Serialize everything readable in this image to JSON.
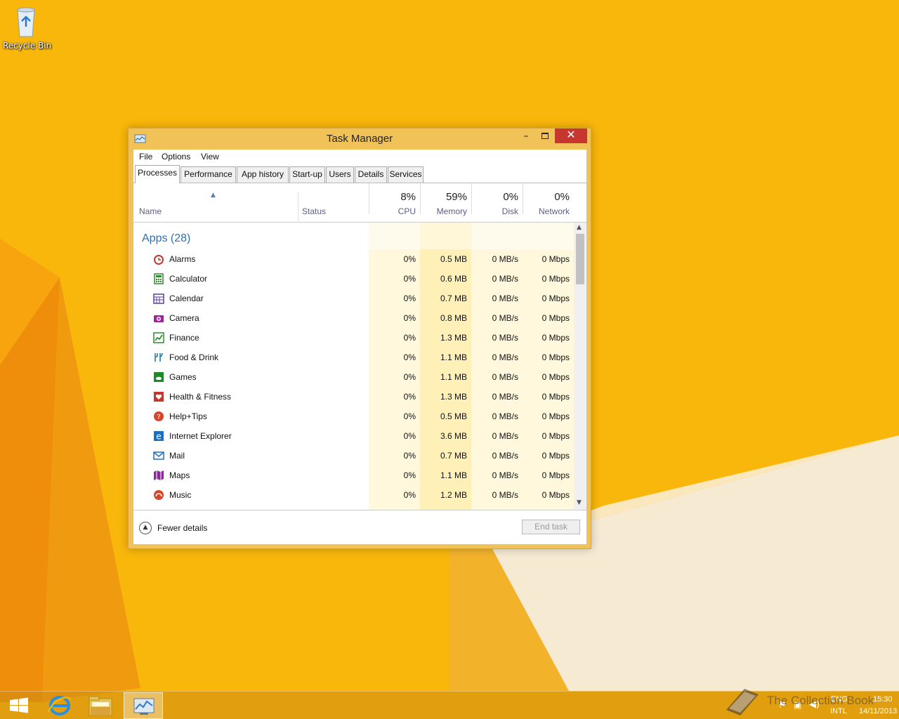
{
  "desktop": {
    "recycle_bin_label": "Recycle Bin"
  },
  "window": {
    "title": "Task Manager",
    "close_glyph": "✕",
    "menu": [
      "File",
      "Options",
      "View"
    ],
    "tabs": [
      "Processes",
      "Performance",
      "App history",
      "Start-up",
      "Users",
      "Details",
      "Services"
    ],
    "active_tab": "Processes",
    "columns": {
      "name": "Name",
      "status": "Status",
      "cpu": {
        "percent": "8%",
        "label": "CPU"
      },
      "memory": {
        "percent": "59%",
        "label": "Memory"
      },
      "disk": {
        "percent": "0%",
        "label": "Disk"
      },
      "network": {
        "percent": "0%",
        "label": "Network"
      }
    },
    "group_title": "Apps (28)",
    "rows": [
      {
        "name": "Alarms",
        "icon": "alarms-icon",
        "color": "#c0392b",
        "cpu": "0%",
        "memory": "0.5 MB",
        "disk": "0 MB/s",
        "network": "0 Mbps"
      },
      {
        "name": "Calculator",
        "icon": "calculator-icon",
        "color": "#2e8b2e",
        "cpu": "0%",
        "memory": "0.6 MB",
        "disk": "0 MB/s",
        "network": "0 Mbps"
      },
      {
        "name": "Calendar",
        "icon": "calendar-icon",
        "color": "#5b3fa0",
        "cpu": "0%",
        "memory": "0.7 MB",
        "disk": "0 MB/s",
        "network": "0 Mbps"
      },
      {
        "name": "Camera",
        "icon": "camera-icon",
        "color": "#a0259a",
        "cpu": "0%",
        "memory": "0.8 MB",
        "disk": "0 MB/s",
        "network": "0 Mbps"
      },
      {
        "name": "Finance",
        "icon": "finance-icon",
        "color": "#2e8b2e",
        "cpu": "0%",
        "memory": "1.3 MB",
        "disk": "0 MB/s",
        "network": "0 Mbps"
      },
      {
        "name": "Food & Drink",
        "icon": "food-drink-icon",
        "color": "#1f7fa8",
        "cpu": "0%",
        "memory": "1.1 MB",
        "disk": "0 MB/s",
        "network": "0 Mbps"
      },
      {
        "name": "Games",
        "icon": "games-icon",
        "color": "#1d8a2a",
        "cpu": "0%",
        "memory": "1.1 MB",
        "disk": "0 MB/s",
        "network": "0 Mbps"
      },
      {
        "name": "Health & Fitness",
        "icon": "health-fitness-icon",
        "color": "#c0392b",
        "cpu": "0%",
        "memory": "1.3 MB",
        "disk": "0 MB/s",
        "network": "0 Mbps"
      },
      {
        "name": "Help+Tips",
        "icon": "help-tips-icon",
        "color": "#d9452b",
        "cpu": "0%",
        "memory": "0.5 MB",
        "disk": "0 MB/s",
        "network": "0 Mbps"
      },
      {
        "name": "Internet Explorer",
        "icon": "internet-explorer-icon",
        "color": "#1e6fc0",
        "cpu": "0%",
        "memory": "3.6 MB",
        "disk": "0 MB/s",
        "network": "0 Mbps"
      },
      {
        "name": "Mail",
        "icon": "mail-icon",
        "color": "#1e6fc0",
        "cpu": "0%",
        "memory": "0.7 MB",
        "disk": "0 MB/s",
        "network": "0 Mbps"
      },
      {
        "name": "Maps",
        "icon": "maps-icon",
        "color": "#8a2c9a",
        "cpu": "0%",
        "memory": "1.1 MB",
        "disk": "0 MB/s",
        "network": "0 Mbps"
      },
      {
        "name": "Music",
        "icon": "music-icon",
        "color": "#d9452b",
        "cpu": "0%",
        "memory": "1.2 MB",
        "disk": "0 MB/s",
        "network": "0 Mbps"
      }
    ],
    "footer": {
      "fewer_details": "Fewer details",
      "end_task": "End task"
    }
  },
  "taskbar": {
    "language": "ENG",
    "layout": "INTL",
    "time": "15:30",
    "date": "14/11/2013",
    "watermark": "The Collection Book"
  },
  "colors": {
    "accent_blue": "#2c6fb5",
    "close_red": "#c7372f",
    "cpu_tint": "#fff8dc",
    "memory_tint": "#fff0b8"
  }
}
